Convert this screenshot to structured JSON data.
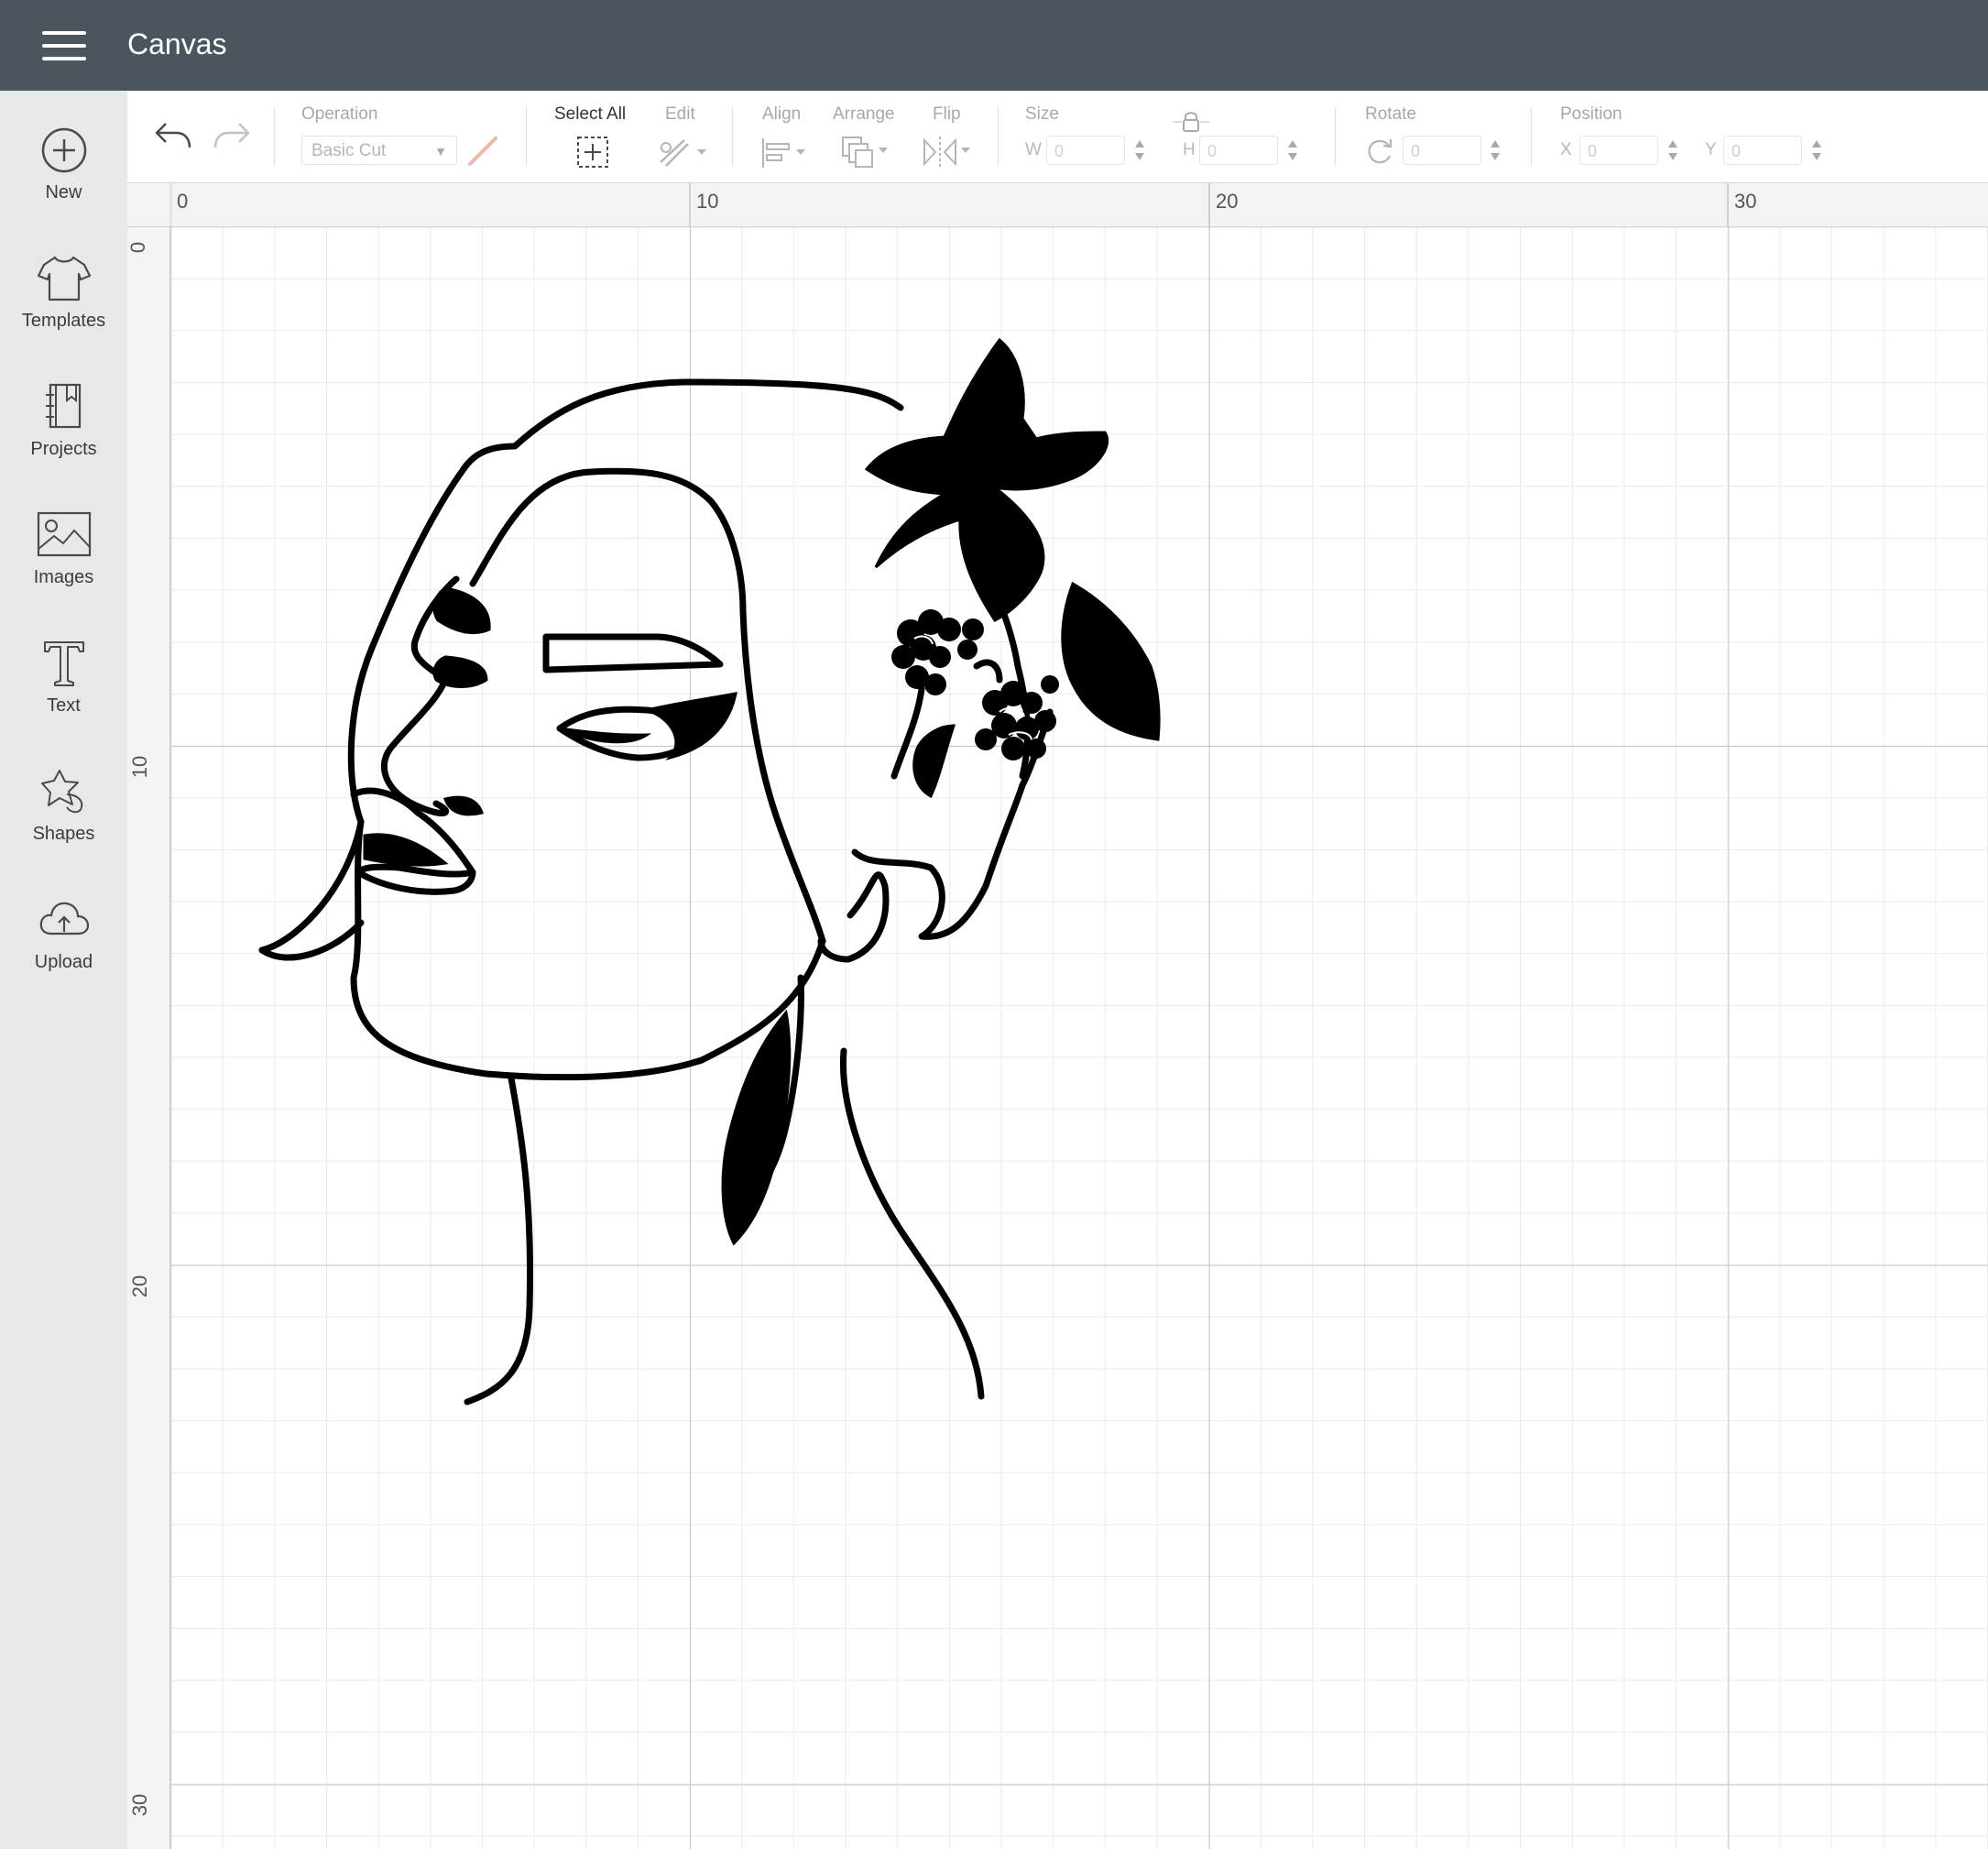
{
  "app": {
    "title": "Canvas"
  },
  "sidebar": {
    "items": [
      {
        "label": "New",
        "icon": "plus-circle-icon"
      },
      {
        "label": "Templates",
        "icon": "tshirt-icon"
      },
      {
        "label": "Projects",
        "icon": "notebook-icon"
      },
      {
        "label": "Images",
        "icon": "image-icon"
      },
      {
        "label": "Text",
        "icon": "text-t-icon"
      },
      {
        "label": "Shapes",
        "icon": "shapes-icon"
      },
      {
        "label": "Upload",
        "icon": "cloud-upload-icon"
      }
    ]
  },
  "toolbar": {
    "operation_label": "Operation",
    "operation_value": "Basic Cut",
    "select_all_label": "Select All",
    "edit_label": "Edit",
    "align_label": "Align",
    "arrange_label": "Arrange",
    "flip_label": "Flip",
    "size_label": "Size",
    "width_label": "W",
    "width_value": "0",
    "height_label": "H",
    "height_value": "0",
    "rotate_label": "Rotate",
    "rotate_value": "0",
    "position_label": "Position",
    "x_label": "X",
    "x_value": "0",
    "y_label": "Y",
    "y_value": "0"
  },
  "ruler": {
    "top": [
      "0",
      "10",
      "20",
      "30"
    ],
    "left": [
      "0",
      "10",
      "20",
      "30"
    ]
  },
  "colors": {
    "topbar": "#4a555e",
    "sidebar": "#e7e8ea",
    "artwork": "#000000"
  }
}
